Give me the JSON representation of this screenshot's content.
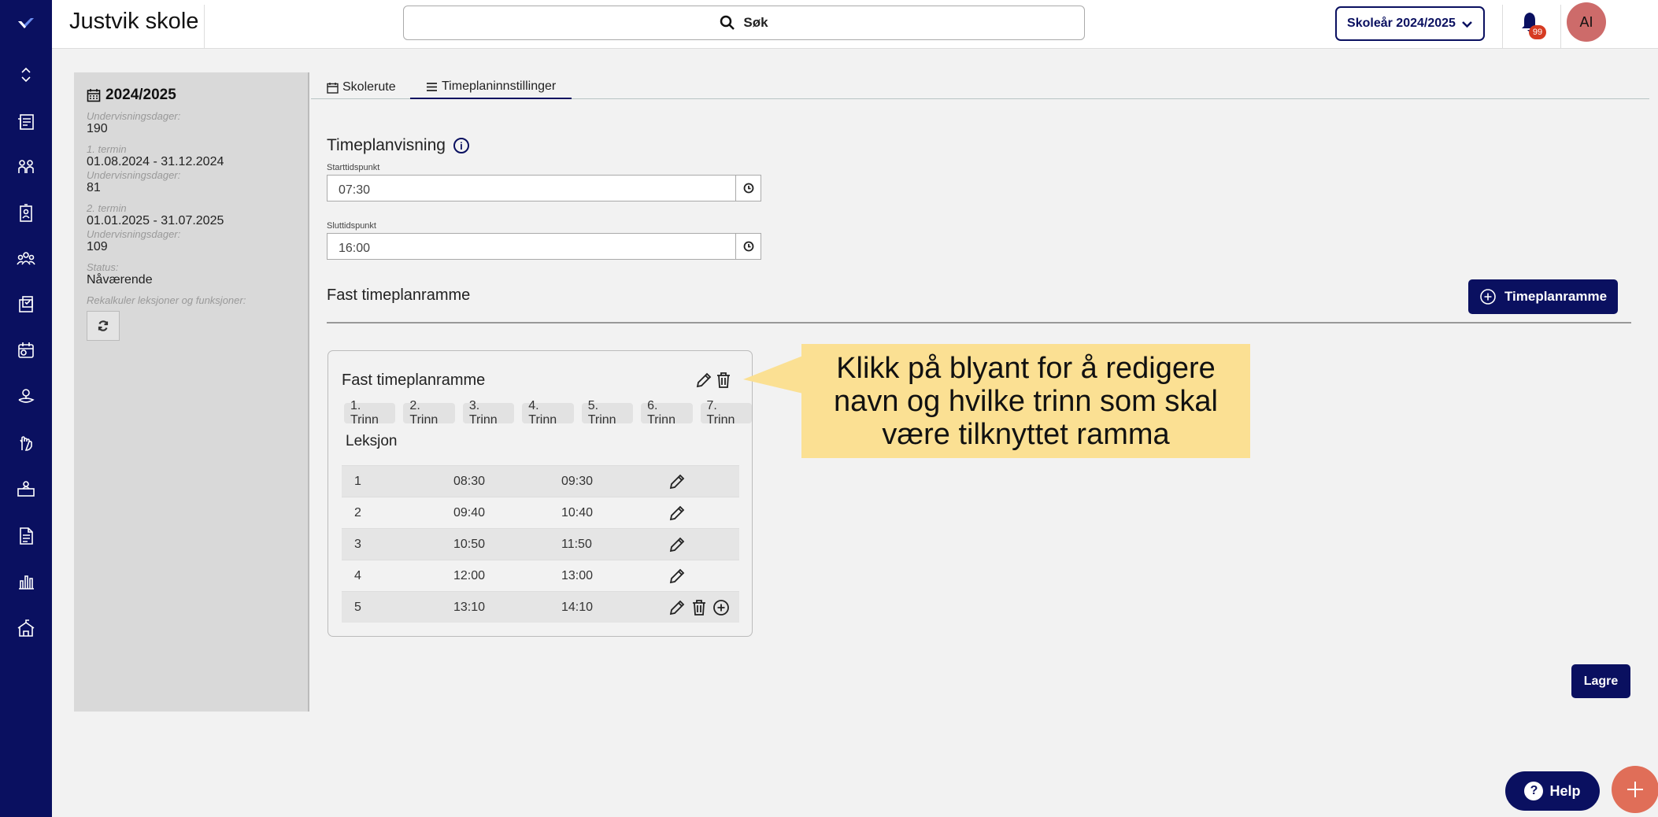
{
  "app": {
    "title": "Justvik skole"
  },
  "search": {
    "label": "Søk"
  },
  "header": {
    "school_year": "Skoleår 2024/2025",
    "notification_count": "99",
    "avatar_initials": "AI"
  },
  "sidebar": {
    "items": [
      "logo",
      "collapse",
      "news",
      "students",
      "reports",
      "groups",
      "assignments",
      "schedule",
      "location",
      "gestures",
      "teaching",
      "documents",
      "statistics",
      "school"
    ]
  },
  "summary": {
    "year": "2024/2025",
    "teaching_days_label": "Undervisningsdager:",
    "teaching_days": "190",
    "term1_label": "1. termin",
    "term1_dates": "01.08.2024 - 31.12.2024",
    "term1_days_label": "Undervisningsdager:",
    "term1_days": "81",
    "term2_label": "2. termin",
    "term2_dates": "01.01.2025 - 31.07.2025",
    "term2_days_label": "Undervisningsdager:",
    "term2_days": "109",
    "status_label": "Status:",
    "status": "Nåværende",
    "recalc_label": "Rekalkuler leksjoner og funksjoner:"
  },
  "tabs": [
    {
      "label": "Skolerute"
    },
    {
      "label": "Timeplaninnstillinger"
    }
  ],
  "timeplanvisning": {
    "title": "Timeplanvisning",
    "info": "i",
    "start_label": "Starttidspunkt",
    "start_value": "07:30",
    "end_label": "Sluttidspunkt",
    "end_value": "16:00"
  },
  "fast": {
    "title": "Fast timeplanramme",
    "add_button": "Timeplanramme"
  },
  "card": {
    "title": "Fast timeplanramme",
    "levels": [
      "1. Trinn",
      "2. Trinn",
      "3. Trinn",
      "4. Trinn",
      "5. Trinn",
      "6. Trinn",
      "7. Trinn"
    ],
    "lessons_label": "Leksjon",
    "rows": [
      {
        "num": "1",
        "start": "08:30",
        "end": "09:30"
      },
      {
        "num": "2",
        "start": "09:40",
        "end": "10:40"
      },
      {
        "num": "3",
        "start": "10:50",
        "end": "11:50"
      },
      {
        "num": "4",
        "start": "12:00",
        "end": "13:00"
      },
      {
        "num": "5",
        "start": "13:10",
        "end": "14:10"
      }
    ]
  },
  "callout": {
    "text": "Klikk på blyant for å redigere navn og hvilke trinn som skal være tilknyttet ramma"
  },
  "actions": {
    "save": "Lagre",
    "help": "Help",
    "help_icon": "?"
  },
  "colors": {
    "navy": "#0a1060",
    "callout": "#fbe093",
    "fab": "#e06e58",
    "avatar": "#cd6b6a"
  }
}
